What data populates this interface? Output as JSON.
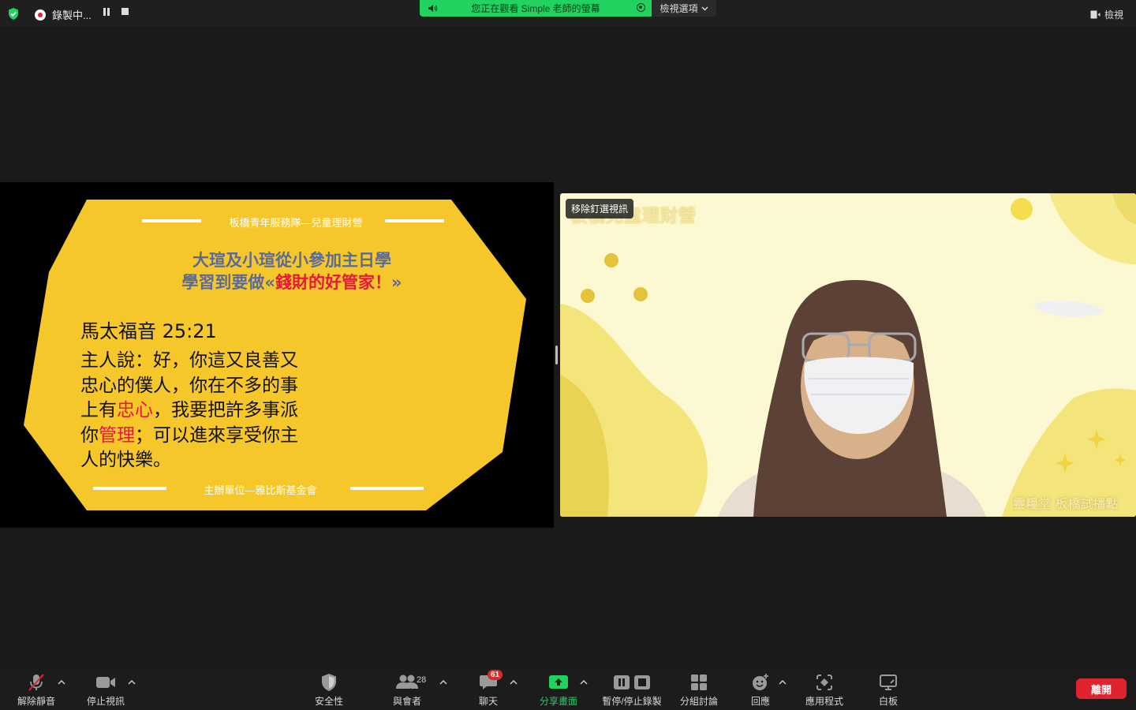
{
  "topbar": {
    "security_icon": "shield-check-icon",
    "recording_label": "錄製中...",
    "share_banner": "您正在觀看 Simple 老師的螢幕",
    "view_options": "檢視選項",
    "view_label": "檢視"
  },
  "slide": {
    "header": "板橋青年服務隊—兒童理財營",
    "title_line1": "大瑄及小瑄從小參加主日學",
    "title_line2_prefix": "學習到要做«",
    "title_line2_red": "錢財的好管家！",
    "title_line2_suffix": "»",
    "verse_ref": "馬太福音 25:21",
    "verse_part1": "主人說：好，你這又良善又\n忠心的僕人，你在不多的事\n上有",
    "verse_red1": "忠心",
    "verse_part2": "，我要把許多事派\n你",
    "verse_red2": "管理",
    "verse_part3": "；可以進來享受你主\n人的快樂。",
    "footer": "主辦單位—雅比斯基金會",
    "bg_color": "#f6c72b",
    "accent_red": "#e8173b",
    "title_color": "#5a6b9a"
  },
  "video": {
    "unpin_label": "移除釘選視訊",
    "background_title": "板橋兒童理財營",
    "background_bottom": "靈糧堂 板橋試播點",
    "bg_color": "#fcf9d2"
  },
  "toolbar": {
    "unmute": "解除靜音",
    "stop_video": "停止視訊",
    "security": "安全性",
    "participants": "與會者",
    "participants_count": "28",
    "chat": "聊天",
    "chat_badge": "61",
    "share": "分享畫面",
    "pause_record": "暫停/停止錄製",
    "breakout": "分組討論",
    "reactions": "回應",
    "apps": "應用程式",
    "whiteboard": "白板",
    "leave": "離開",
    "leave_color": "#e0242f",
    "share_color": "#23d160"
  }
}
